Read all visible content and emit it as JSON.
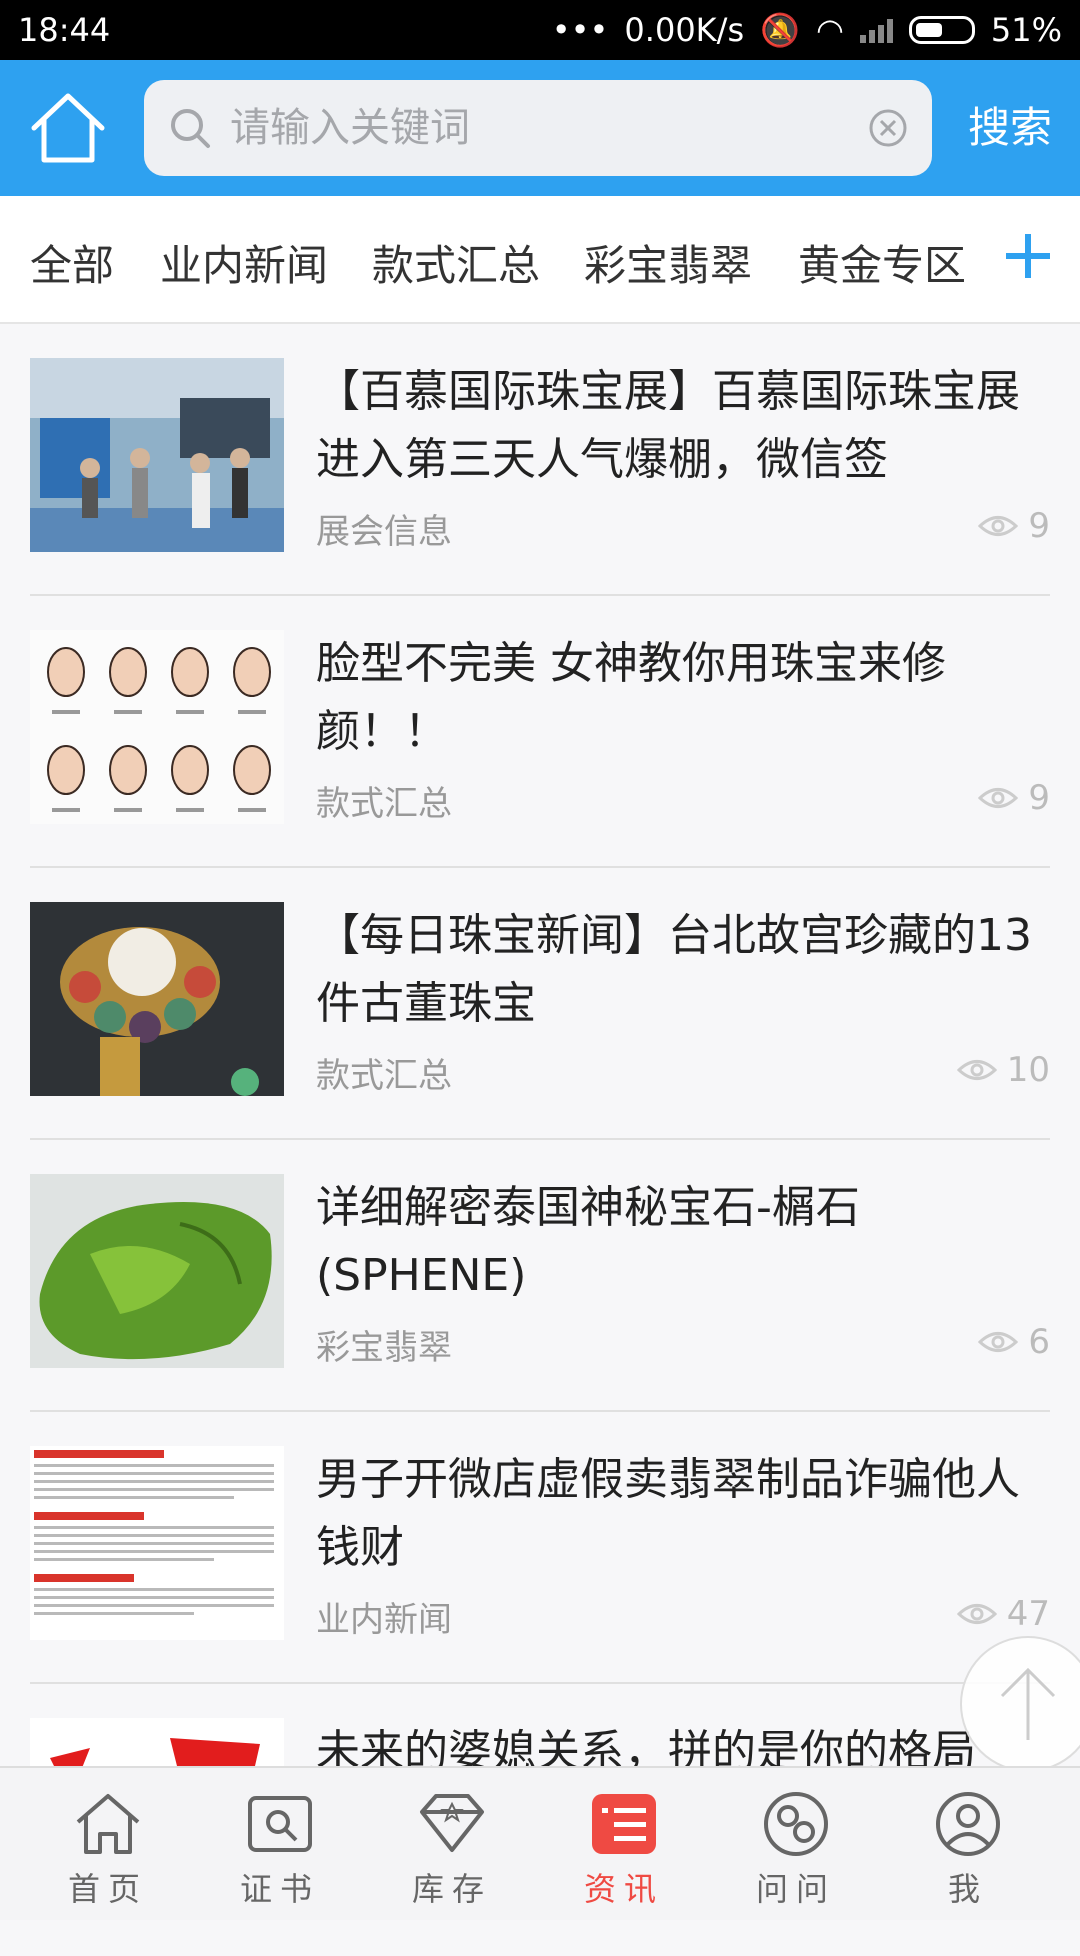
{
  "status": {
    "time": "18:44",
    "net_speed": "0.00K/s",
    "battery": "51%"
  },
  "header": {
    "search_placeholder": "请输入关键词",
    "search_button": "搜索"
  },
  "tabs": [
    "全部",
    "业内新闻",
    "款式汇总",
    "彩宝翡翠",
    "黄金专区"
  ],
  "articles": [
    {
      "title": "【百慕国际珠宝展】百慕国际珠宝展进入第三天人气爆棚，微信签",
      "category": "展会信息",
      "views": "9"
    },
    {
      "title": "脸型不完美 女神教你用珠宝来修颜！！",
      "category": "款式汇总",
      "views": "9"
    },
    {
      "title": "【每日珠宝新闻】台北故宫珍藏的13件古董珠宝",
      "category": "款式汇总",
      "views": "10"
    },
    {
      "title": "详细解密泰国神秘宝石-榍石(SPHENE)",
      "category": "彩宝翡翠",
      "views": "6"
    },
    {
      "title": "男子开微店虚假卖翡翠制品诈骗他人钱财",
      "category": "业内新闻",
      "views": "47"
    },
    {
      "title": "未来的婆媳关系，拼的是你的格局",
      "category": "",
      "views": ""
    }
  ],
  "bottom_nav": [
    {
      "label": "首页",
      "icon": "home-icon"
    },
    {
      "label": "证书",
      "icon": "certificate-icon"
    },
    {
      "label": "库存",
      "icon": "diamond-icon"
    },
    {
      "label": "资讯",
      "icon": "news-icon",
      "active": true
    },
    {
      "label": "问问",
      "icon": "chat-icon"
    },
    {
      "label": "我",
      "icon": "user-icon"
    }
  ],
  "colors": {
    "accent": "#2ea1f0",
    "active_nav": "#ef4a43"
  }
}
